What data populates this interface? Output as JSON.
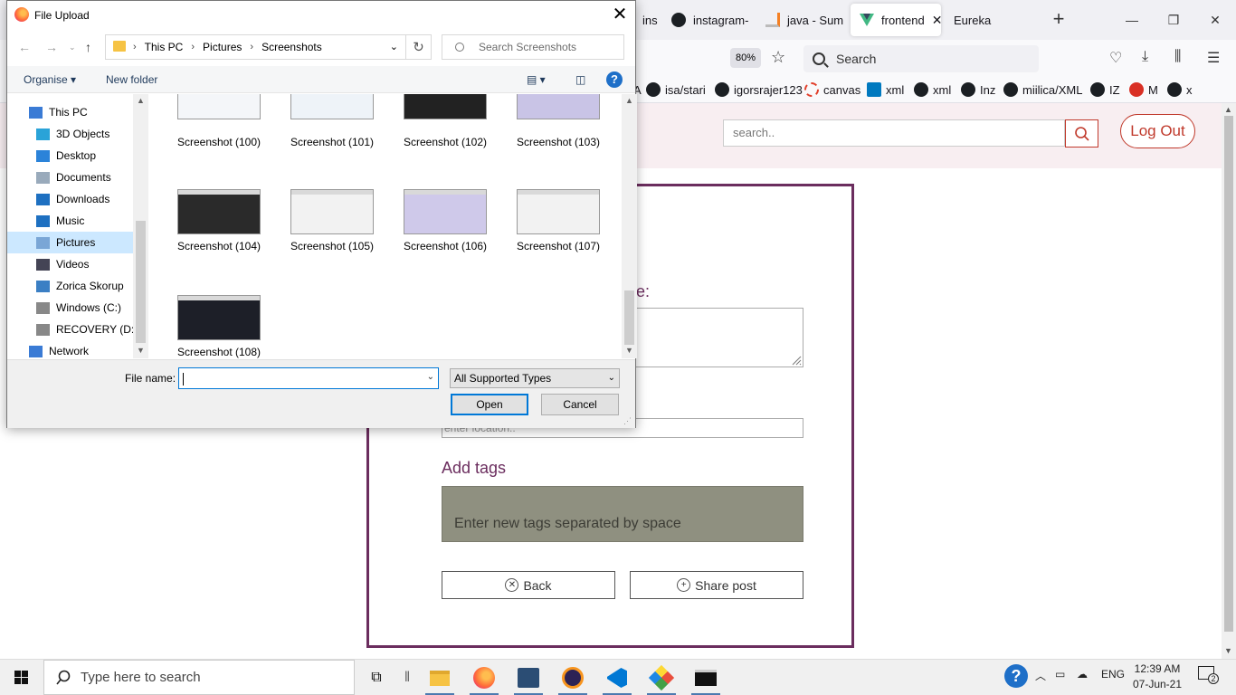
{
  "browser": {
    "tabs": [
      {
        "label": "ins"
      },
      {
        "label": "instagram-"
      },
      {
        "label": "java - Sum"
      },
      {
        "label": "frontend"
      },
      {
        "label": "Eureka"
      }
    ],
    "zoom": "80%",
    "search_placeholder": "Search",
    "bookmarks": [
      {
        "label": "A"
      },
      {
        "label": "isa/stari"
      },
      {
        "label": "igorsrajer123"
      },
      {
        "label": "canvas"
      },
      {
        "label": "xml"
      },
      {
        "label": "xml"
      },
      {
        "label": "Inz"
      },
      {
        "label": "miilica/XML"
      },
      {
        "label": "IZ"
      },
      {
        "label": "M"
      },
      {
        "label": "x"
      }
    ]
  },
  "site": {
    "search_placeholder": "search..",
    "logout_label": "Log Out",
    "description_label_tail": "e:",
    "location_placeholder": "enter location..",
    "tags_label": "Add tags",
    "tags_placeholder": "Enter new tags separated by space",
    "back_label": "Back",
    "share_label": "Share post"
  },
  "dialog": {
    "title": "File Upload",
    "breadcrumb": [
      "This PC",
      "Pictures",
      "Screenshots"
    ],
    "search_placeholder": "Search Screenshots",
    "organise_label": "Organise",
    "new_folder_label": "New folder",
    "nav_items": [
      {
        "label": "This PC",
        "icon": "pc-icon"
      },
      {
        "label": "3D Objects",
        "icon": "cube-icon"
      },
      {
        "label": "Desktop",
        "icon": "desktop-icon"
      },
      {
        "label": "Documents",
        "icon": "document-icon"
      },
      {
        "label": "Downloads",
        "icon": "download-icon"
      },
      {
        "label": "Music",
        "icon": "music-icon"
      },
      {
        "label": "Pictures",
        "icon": "pictures-icon"
      },
      {
        "label": "Videos",
        "icon": "video-icon"
      },
      {
        "label": "Zorica Skorup",
        "icon": "user-folder-icon"
      },
      {
        "label": "Windows (C:)",
        "icon": "drive-icon"
      },
      {
        "label": "RECOVERY (D:)",
        "icon": "drive-icon"
      },
      {
        "label": "Network",
        "icon": "network-icon"
      }
    ],
    "files": [
      {
        "name": "Screenshot (100)"
      },
      {
        "name": "Screenshot (101)"
      },
      {
        "name": "Screenshot (102)"
      },
      {
        "name": "Screenshot (103)"
      },
      {
        "name": "Screenshot (104)"
      },
      {
        "name": "Screenshot (105)"
      },
      {
        "name": "Screenshot (106)"
      },
      {
        "name": "Screenshot (107)"
      },
      {
        "name": "Screenshot (108)"
      }
    ],
    "filename_label": "File name:",
    "filename_value": "",
    "file_type": "All Supported Types",
    "open_label": "Open",
    "cancel_label": "Cancel"
  },
  "taskbar": {
    "search_placeholder": "Type here to search",
    "language": "ENG",
    "time": "12:39 AM",
    "date": "07-Jun-21",
    "notifications": "2"
  }
}
